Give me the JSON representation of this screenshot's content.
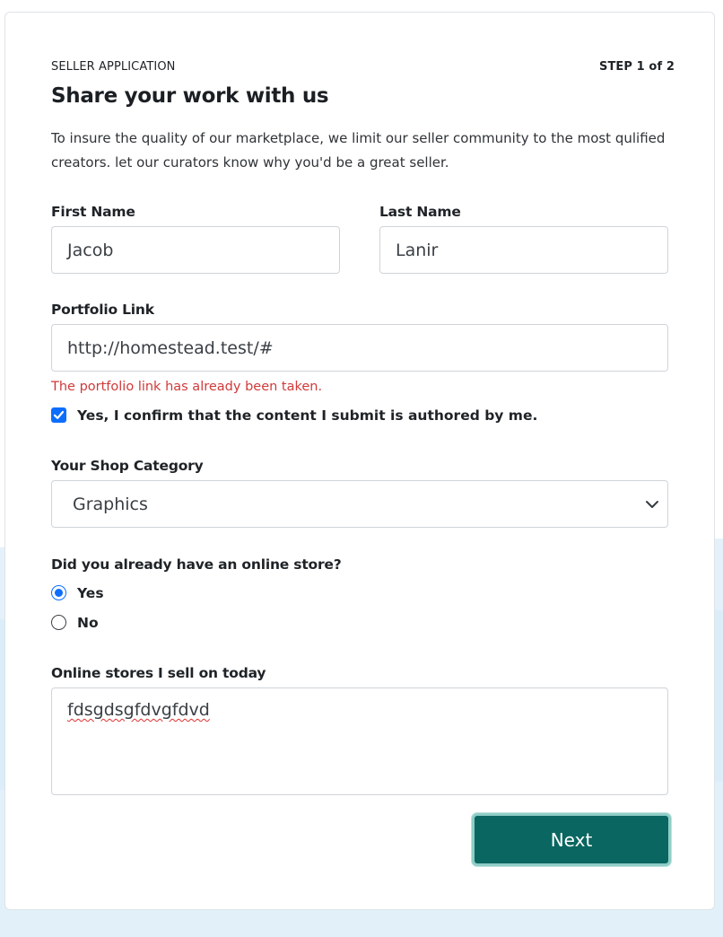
{
  "header": {
    "eyebrow": "SELLER APPLICATION",
    "step": "STEP 1 of 2",
    "title": "Share your work with us",
    "description": "To insure the quality of our marketplace, we limit our seller community to the most qulified creators. let our curators know why you'd be a great seller."
  },
  "fields": {
    "first_name": {
      "label": "First Name",
      "value": "Jacob"
    },
    "last_name": {
      "label": "Last Name",
      "value": "Lanir"
    },
    "portfolio": {
      "label": "Portfolio Link",
      "value": "http://homestead.test/#",
      "error": "The portfolio link has already been taken."
    },
    "confirm": {
      "label": "Yes, I confirm that the content I submit is authored by me.",
      "checked": true
    },
    "category": {
      "label": "Your Shop Category",
      "selected": "Graphics"
    },
    "online_store": {
      "label": "Did you already have an online store?",
      "options": [
        {
          "label": "Yes",
          "selected": true
        },
        {
          "label": "No",
          "selected": false
        }
      ]
    },
    "stores": {
      "label": "Online stores I sell on today",
      "value": "fdsgdsgfdvgfdvd"
    }
  },
  "actions": {
    "next_label": "Next"
  },
  "icons": {
    "checkbox": "checkmark-icon",
    "select": "chevron-down-icon"
  },
  "colors": {
    "accent": "#0d6efd",
    "button": "#0a6660",
    "button_ring": "#8fcdc6",
    "error": "#d03a3a"
  }
}
